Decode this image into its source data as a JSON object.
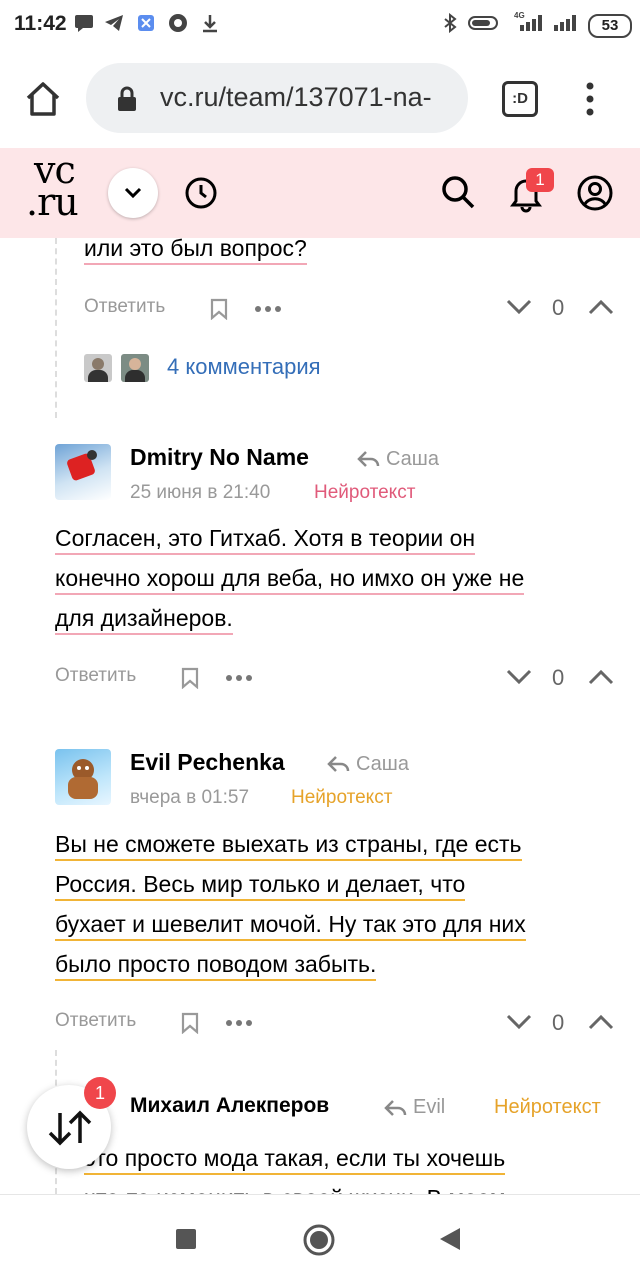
{
  "status_bar": {
    "time": "11:42",
    "battery": "53",
    "network": "4G"
  },
  "browser": {
    "url": "vc.ru/team/137071-na-",
    "tabs_label": ":D"
  },
  "site": {
    "logo_top": "vc",
    "logo_bottom": ".ru",
    "notifications_count": "1"
  },
  "prev_comment": {
    "tail_text": "или это был вопрос?",
    "reply_label": "Ответить",
    "score": "0",
    "replies_link": "4 комментария"
  },
  "comments": [
    {
      "author": "Dmitry No Name",
      "reply_to": "Саша",
      "date": "25 июня в 21:40",
      "tag": "Нейротекст",
      "lines": [
        "Согласен, это Гитхаб. Хотя в теории он",
        "конечно хорош для веба, но имхо он уже не",
        "для дизайнеров."
      ],
      "reply_label": "Ответить",
      "score": "0"
    },
    {
      "author": "Evil Pechenka",
      "reply_to": "Саша",
      "date": "вчера в 01:57",
      "tag": "Нейротекст",
      "lines": [
        "Вы не сможете выехать из страны, где есть",
        "Россия. Весь мир только и делает, что",
        "бухает и шевелит мочой. Ну так это для них",
        "было просто поводом забыть."
      ],
      "reply_label": "Ответить",
      "score": "0"
    },
    {
      "author": "Михаил Алекперов",
      "reply_to": "Evil",
      "tag": "Нейротекст",
      "lines": [
        "это просто мода такая, если ты хочешь",
        "что-то изменить в своей жизни. В моем"
      ]
    }
  ],
  "fab": {
    "badge": "1"
  },
  "colors": {
    "header_bg": "#fde6e8",
    "link": "#346eb8",
    "badge": "#f0464b",
    "neuro_pink": "#e05a7a",
    "neuro_yellow": "#e6a32a"
  }
}
